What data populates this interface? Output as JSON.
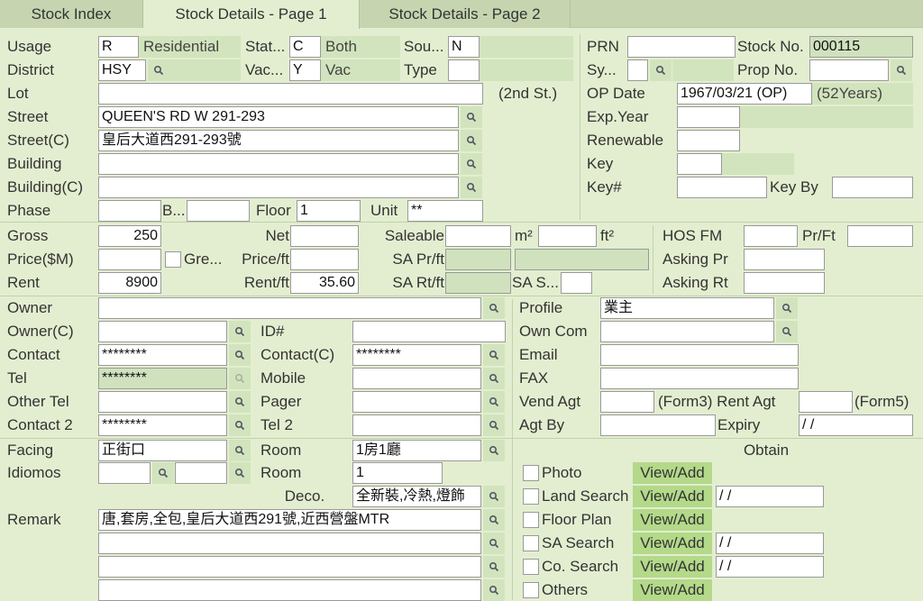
{
  "tabs": [
    "Stock Index",
    "Stock Details - Page 1",
    "Stock Details - Page 2"
  ],
  "top": {
    "usage_label": "Usage",
    "usage_value": "R",
    "usage_desc": "Residential",
    "status_label": "Stat...",
    "status_value": "C",
    "status_desc": "Both",
    "source_label": "Sou...",
    "source_value": "N",
    "district_label": "District",
    "district_value": "HSY",
    "vacant_label": "Vac...",
    "vacant_value": "Y",
    "vacant_desc": "Vac",
    "type_label": "Type",
    "type_value": "",
    "lot_label": "Lot",
    "lot_value": "",
    "lot_note": "(2nd St.)",
    "street_label": "Street",
    "street_value": "QUEEN'S RD W 291-293",
    "street_c_label": "Street(C)",
    "street_c_value": "皇后大道西291-293號",
    "building_label": "Building",
    "building_value": "",
    "building_c_label": "Building(C)",
    "building_c_value": "",
    "phase_label": "Phase",
    "phase_value": "",
    "block_label": "B...",
    "block_value": "",
    "floor_label": "Floor",
    "floor_value": "1",
    "unit_label": "Unit",
    "unit_value": "**"
  },
  "right_top": {
    "prn_label": "PRN",
    "prn_value": "",
    "stock_no_label": "Stock No.",
    "stock_no_value": "000115",
    "sy_label": "Sy...",
    "sy_value": "",
    "prop_no_label": "Prop No.",
    "prop_no_value": "",
    "op_date_label": "OP Date",
    "op_date_value": "1967/03/21 (OP)",
    "op_years": "(52Years)",
    "exp_year_label": "Exp.Year",
    "exp_year_value": "",
    "renewable_label": "Renewable",
    "renewable_value": "",
    "key_label": "Key",
    "key_value": "",
    "key_no_label": "Key#",
    "key_no_value": "",
    "key_by_label": "Key By",
    "key_by_value": ""
  },
  "area": {
    "gross_label": "Gross",
    "gross_value": "250",
    "net_label": "Net",
    "net_value": "",
    "saleable_label": "Saleable",
    "saleable_value": "",
    "m2_unit": "m²",
    "m2_value": "",
    "ft2_unit": "ft²",
    "hos_label": "HOS FM",
    "hos_value": "",
    "prft_label": "Pr/Ft",
    "prft_value": "",
    "price_label": "Price($M)",
    "price_value": "",
    "green_label": "Gre...",
    "price_ft_label": "Price/ft",
    "price_ft_value": "",
    "sa_prft_label": "SA Pr/ft",
    "sa_prft_value": "",
    "asking_pr_label": "Asking Pr",
    "asking_pr_value": "",
    "rent_label": "Rent",
    "rent_value": "8900",
    "rent_ft_label": "Rent/ft",
    "rent_ft_value": "35.60",
    "sa_rtft_label": "SA Rt/ft",
    "sa_rtft_value": "",
    "sa_s_label": "SA S...",
    "sa_s_value": "",
    "asking_rt_label": "Asking Rt",
    "asking_rt_value": ""
  },
  "owner": {
    "owner_label": "Owner",
    "owner_value": "",
    "owner_c_label": "Owner(C)",
    "owner_c_value": "",
    "id_label": "ID#",
    "id_value": "",
    "contact_label": "Contact",
    "contact_value": "********",
    "contact_c_label": "Contact(C)",
    "contact_c_value": "********",
    "tel_label": "Tel",
    "tel_value": "********",
    "mobile_label": "Mobile",
    "mobile_value": "",
    "other_tel_label": "Other Tel",
    "other_tel_value": "",
    "pager_label": "Pager",
    "pager_value": "",
    "contact2_label": "Contact 2",
    "contact2_value": "********",
    "tel2_label": "Tel 2",
    "tel2_value": "",
    "profile_label": "Profile",
    "profile_value": "業主",
    "own_com_label": "Own Com",
    "own_com_value": "",
    "email_label": "Email",
    "email_value": "",
    "fax_label": "FAX",
    "fax_value": "",
    "vend_agt_label": "Vend Agt",
    "vend_agt_value": "",
    "form3_label": "(Form3) Rent Agt",
    "rent_agt_value": "",
    "form5_label": "(Form5)",
    "agt_by_label": "Agt By",
    "agt_by_value": "",
    "expiry_label": "Expiry",
    "expiry_value": " / /"
  },
  "bottom": {
    "facing_label": "Facing",
    "facing_value": "正街口",
    "idiomos_label": "Idiomos",
    "idiomos_value1": "",
    "idiomos_value2": "",
    "room_label": "Room",
    "room_value": "1房1廳",
    "room2_label": "Room",
    "room2_value": "1",
    "deco_label": "Deco.",
    "deco_value": "全新裝,冷熱,燈飾",
    "remark_label": "Remark",
    "remarks": [
      "唐,套房,全包,皇后大道西291號,近西營盤MTR",
      "",
      "",
      ""
    ],
    "obtain_label": "Obtain",
    "view_add_label": "View/Add",
    "obtain_items": [
      {
        "label": "Photo",
        "date": null
      },
      {
        "label": "Land Search",
        "date": " / /"
      },
      {
        "label": "Floor Plan",
        "date": null
      },
      {
        "label": "SA Search",
        "date": " / /"
      },
      {
        "label": "Co. Search",
        "date": " / /"
      },
      {
        "label": "Others",
        "date": null
      }
    ]
  },
  "colors": {
    "background": "#e3eed0",
    "tab_bar": "#c6d5b0",
    "readonly": "#d2e4bd",
    "view_add": "#b3d989"
  }
}
